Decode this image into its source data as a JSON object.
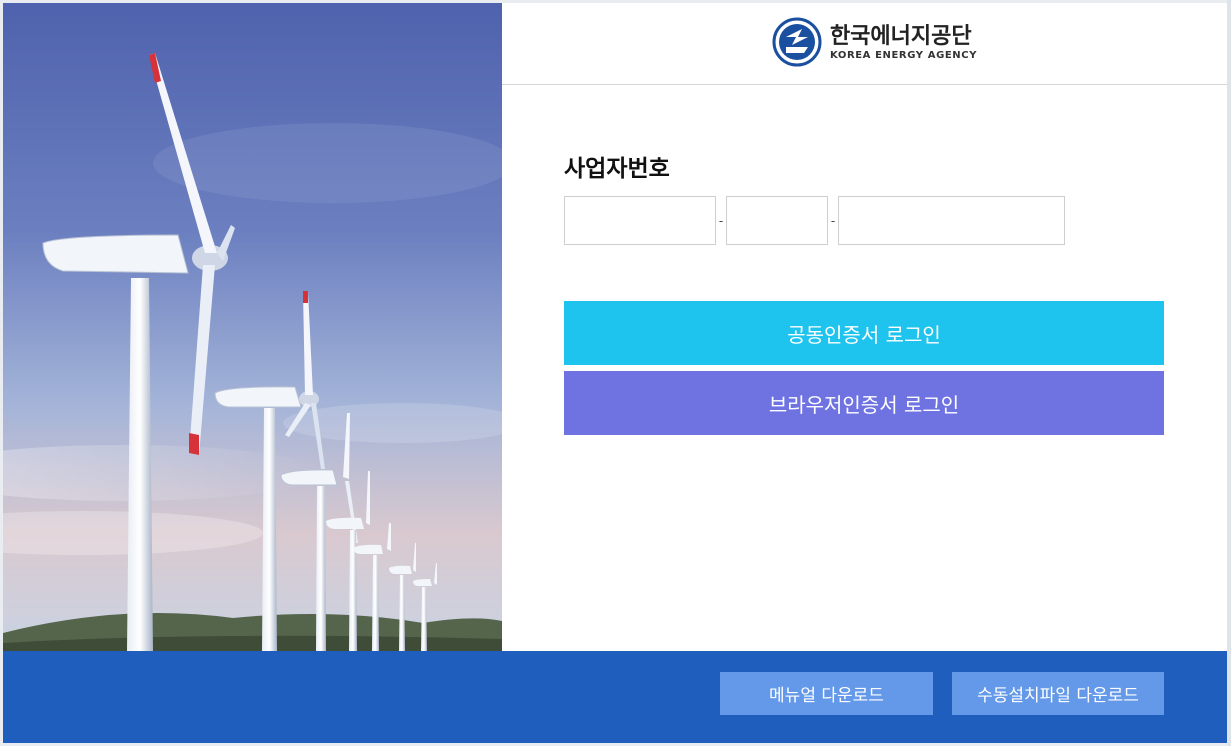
{
  "brand": {
    "name_ko": "한국에너지공단",
    "name_en": "KOREA ENERGY AGENCY",
    "logo_icon": "korea-energy-agency-emblem-icon",
    "color": "#1b4fa0"
  },
  "hero": {
    "image_subject": "wind-turbines"
  },
  "login": {
    "field_label": "사업자번호",
    "business_number": {
      "part1": {
        "value": "",
        "placeholder": ""
      },
      "part2": {
        "value": "",
        "placeholder": ""
      },
      "part3": {
        "value": "",
        "placeholder": ""
      },
      "separator": "-"
    },
    "joint_cert_button": "공동인증서 로그인",
    "browser_cert_button": "브라우저인증서 로그인"
  },
  "footer": {
    "manual_button": "메뉴얼 다운로드",
    "install_button": "수동설치파일 다운로드"
  },
  "colors": {
    "joint_button": "#1ec4ee",
    "browser_button": "#6f73e2",
    "footer_bg": "#1f5ebd",
    "footer_button": "#6399e8"
  }
}
